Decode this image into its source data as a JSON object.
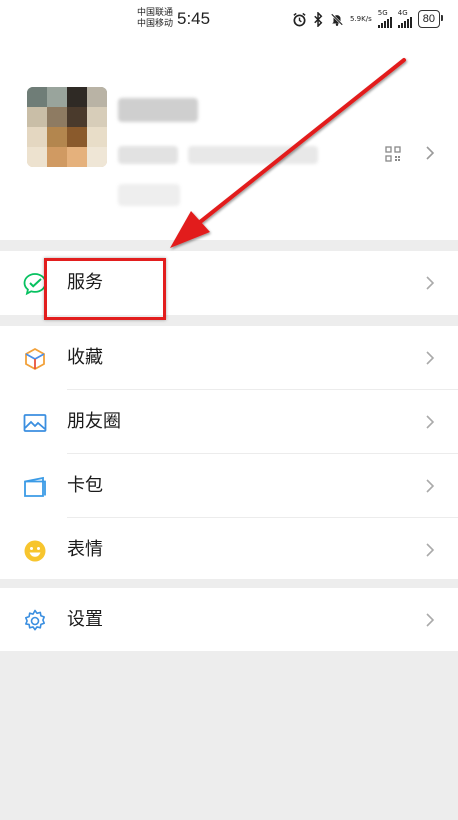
{
  "status_bar": {
    "carrier_1": "中国联通",
    "carrier_2": "中国移动",
    "time": "5:45",
    "net_speed_value": "5.9",
    "net_speed_unit": "K/s",
    "signal_1_tag": "5G",
    "signal_2_tag": "4G",
    "battery": "80",
    "icons": [
      "alarm-icon",
      "bluetooth-icon",
      "mute-bell-icon",
      "signal-icon",
      "signal-icon",
      "battery-icon"
    ]
  },
  "profile": {
    "avatar": "blurred-photo",
    "name": "",
    "qr_icon": "qr-code-icon",
    "chevron_icon": "chevron-right-icon"
  },
  "menu": {
    "services": {
      "label": "服务",
      "icon": "wechat-pay-icon"
    },
    "favorites": {
      "label": "收藏",
      "icon": "cube-icon"
    },
    "moments": {
      "label": "朋友圈",
      "icon": "picture-icon"
    },
    "cards": {
      "label": "卡包",
      "icon": "wallet-icon"
    },
    "stickers": {
      "label": "表情",
      "icon": "smiley-icon"
    },
    "settings": {
      "label": "设置",
      "icon": "gear-icon"
    }
  },
  "colors": {
    "annotation_red": "#e21e1e",
    "wechat_green": "#07c160",
    "divider_gray": "#ededed"
  }
}
